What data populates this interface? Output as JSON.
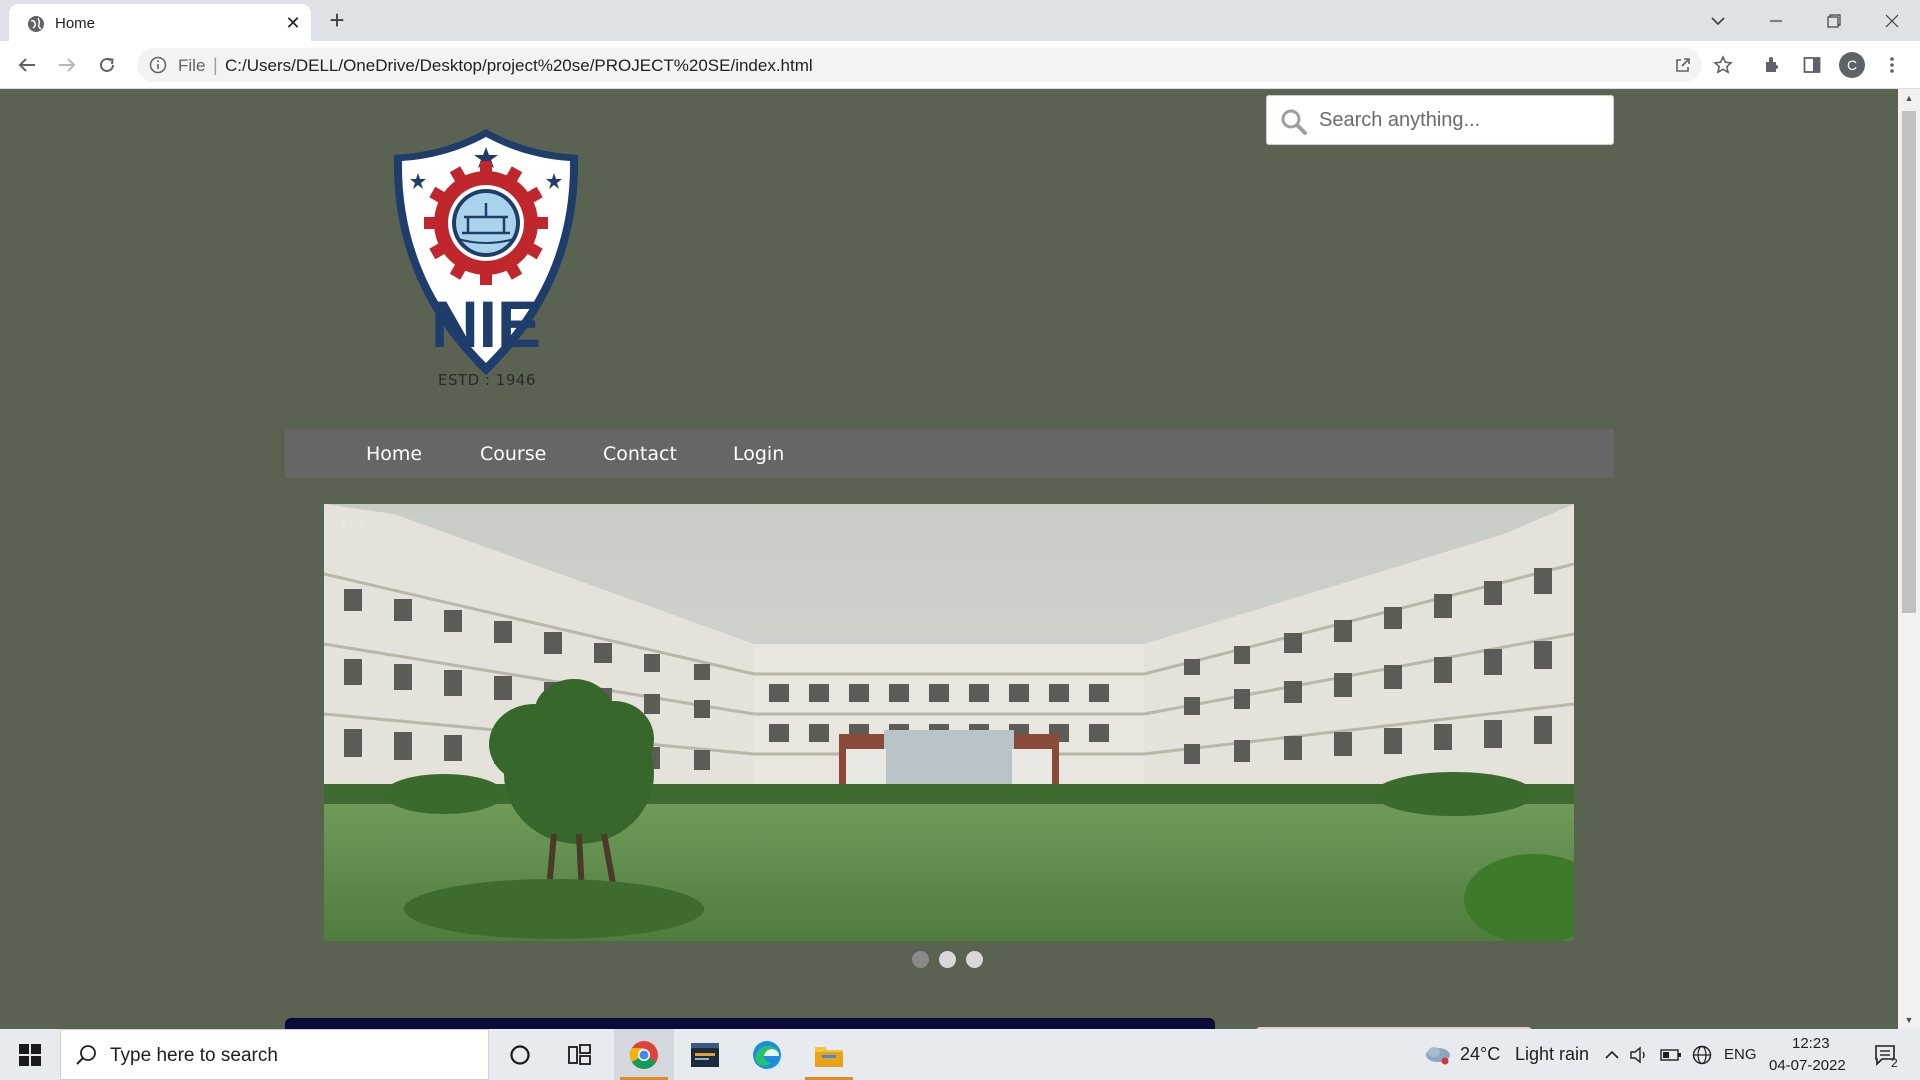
{
  "browser": {
    "tab_title": "Home",
    "new_tab_symbol": "+",
    "close_symbol": "✕",
    "address_scheme": "File",
    "address_url": "C:/Users/DELL/OneDrive/Desktop/project%20se/PROJECT%20SE/index.html",
    "profile_initial": "C"
  },
  "page": {
    "logo_text": "NIE",
    "estd_text": "ESTD : 1946",
    "search": {
      "placeholder": "Search anything..."
    },
    "nav": {
      "items": [
        {
          "label": "Home"
        },
        {
          "label": "Course"
        },
        {
          "label": "Contact"
        },
        {
          "label": "Login"
        }
      ]
    },
    "slider": {
      "slide_number": "1 / 3",
      "dots": [
        {
          "active": false
        },
        {
          "active": true
        },
        {
          "active": true
        }
      ]
    },
    "colors": {
      "page_background": "#5a6352",
      "navbar": "#666666",
      "bottom_bar": "#0b0b3a"
    }
  },
  "taskbar": {
    "search_placeholder": "Type here to search",
    "weather_temp": "24°C",
    "weather_desc": "Light rain",
    "language": "ENG",
    "time": "12:23",
    "date": "04-07-2022",
    "notification_count": "2",
    "apps": [
      "start-icon",
      "cortana-icon",
      "task-view-icon",
      "chrome-icon",
      "mysql-icon",
      "edge-icon",
      "file-explorer-icon"
    ]
  }
}
